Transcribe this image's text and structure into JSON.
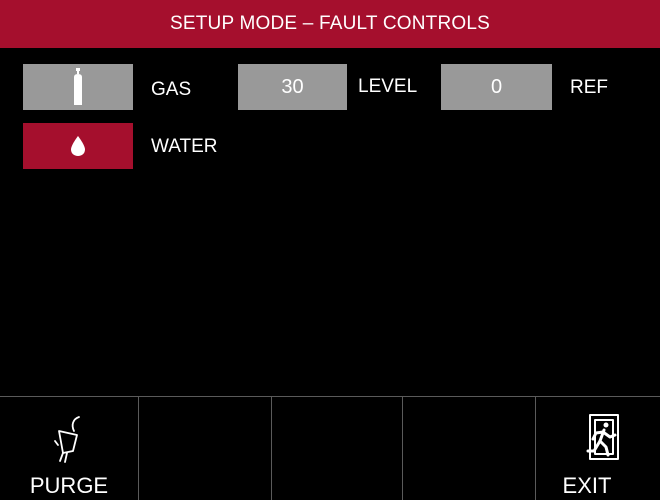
{
  "header": {
    "title": "SETUP MODE – FAULT CONTROLS"
  },
  "faults": {
    "gas": {
      "label": "GAS",
      "icon": "gas-cylinder-icon",
      "active": false
    },
    "level": {
      "value": "30",
      "label": "LEVEL"
    },
    "ref": {
      "value": "0",
      "label": "REF"
    },
    "water": {
      "label": "WATER",
      "icon": "water-drop-icon",
      "active": true
    }
  },
  "footer": {
    "purge": {
      "label": "PURGE",
      "icon": "purge-icon"
    },
    "exit": {
      "label": "EXIT",
      "icon": "exit-running-man-icon"
    }
  },
  "colors": {
    "accent": "#a50f2d",
    "button_gray": "#999999",
    "background": "#000000",
    "divider": "#5a5a5a"
  }
}
